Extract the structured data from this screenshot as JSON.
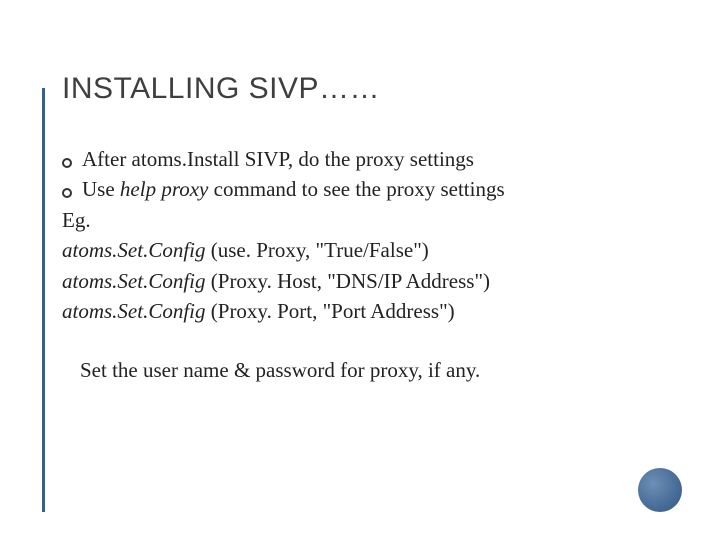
{
  "title": "INSTALLING SIVP……",
  "bullets": [
    {
      "pre": "After atoms.Install SIVP, do the proxy settings"
    },
    {
      "pre": "Use ",
      "italic": "help proxy",
      "post": " command to see the proxy settings"
    }
  ],
  "lines": {
    "eg": "Eg.",
    "l1_cmd": "atoms.Set.Config",
    "l1_rest": " (use. Proxy, \"True/False\")",
    "l2_cmd": "atoms.Set.Config",
    "l2_rest": " (Proxy. Host, \"DNS/IP Address\")",
    "l3_cmd": "atoms.Set.Config",
    "l3_rest": " (Proxy. Port, \"Port Address\")"
  },
  "footer": "Set the user name & password for proxy, if any."
}
